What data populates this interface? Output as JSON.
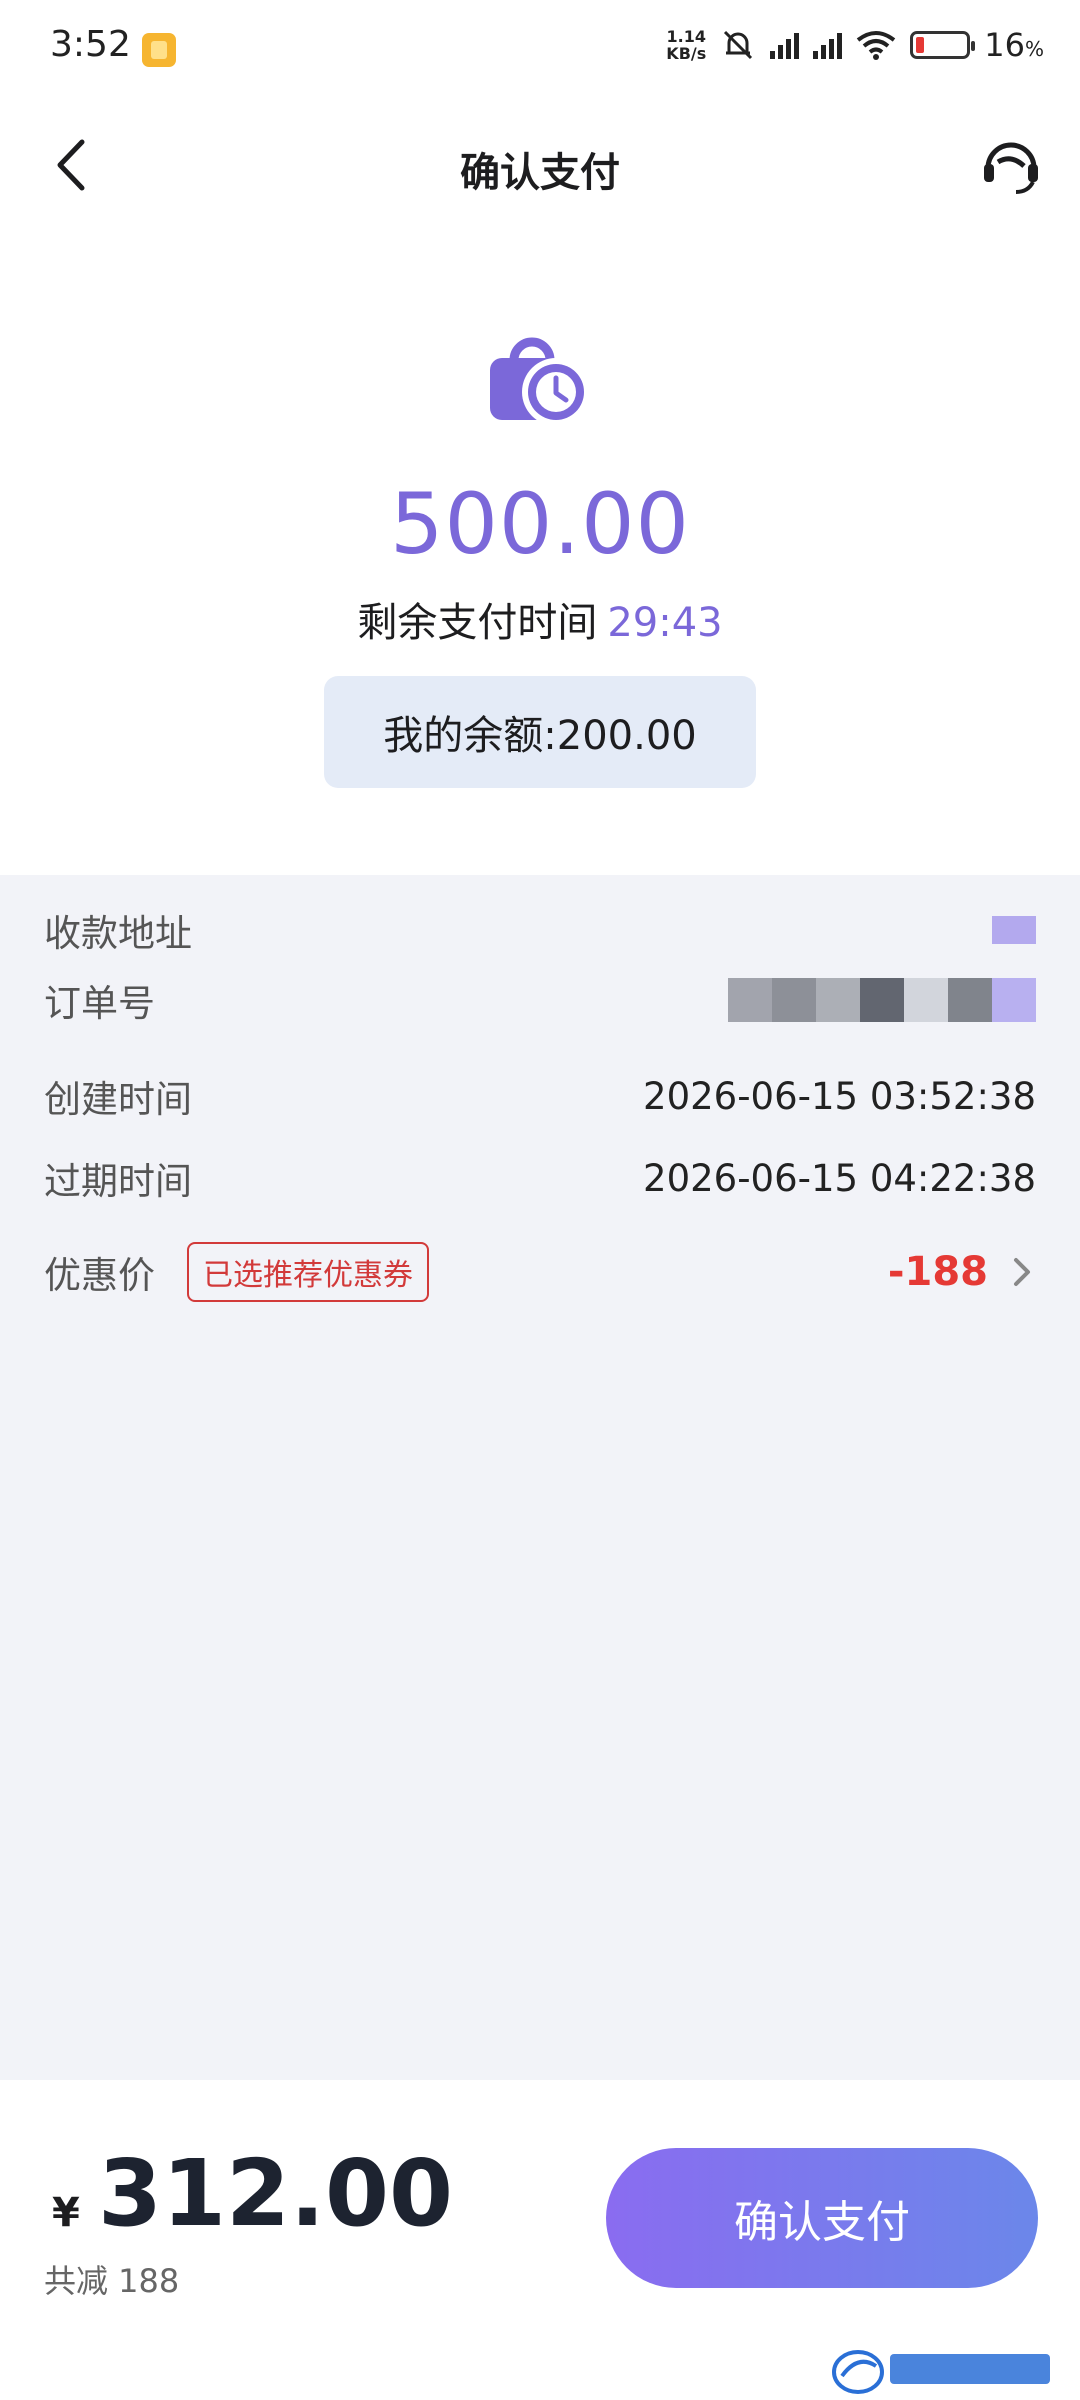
{
  "status_bar": {
    "time": "3:52",
    "net_speed_value": "1.14",
    "net_speed_unit": "KB/s",
    "battery": "16",
    "battery_unit": "%",
    "battery_level": 0.16
  },
  "nav": {
    "title": "确认支付"
  },
  "payment": {
    "amount": "500.00",
    "remaining_label": "剩余支付时间",
    "countdown": "29:43",
    "balance": "我的余额:200.00"
  },
  "details": {
    "rows": [
      {
        "label": "收款地址",
        "value": ""
      },
      {
        "label": "订单号",
        "value": ""
      },
      {
        "label": "创建时间",
        "value": "2026-06-15 03:52:38"
      },
      {
        "label": "过期时间",
        "value": "2026-06-15 04:22:38"
      }
    ],
    "discount": {
      "label": "优惠价",
      "tag": "已选推荐优惠券",
      "value": "-188"
    }
  },
  "footer": {
    "currency": "¥",
    "total": "312.00",
    "saved": "共减 188",
    "pay_button": "确认支付"
  },
  "colors": {
    "accent": "#7b68d9",
    "discount_red": "#e53935",
    "balance_bg": "#e4ebf7",
    "details_bg": "#f2f3f8"
  }
}
